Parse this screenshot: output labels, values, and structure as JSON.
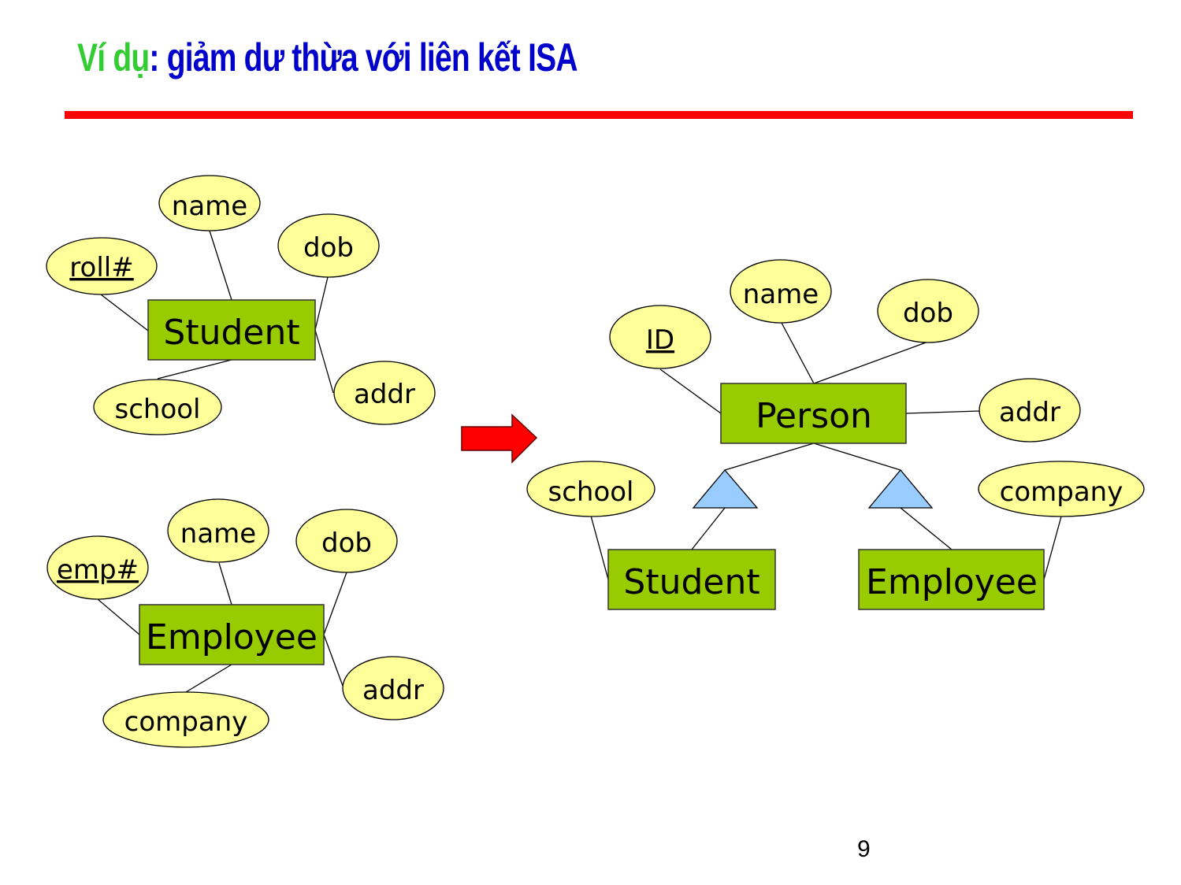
{
  "slide": {
    "title_prefix": "Ví dụ",
    "title_sep": ":",
    "title_main": " giảm dư thừa với liên kết ISA",
    "page_number": "9",
    "colors": {
      "title_prefix": "#33cc33",
      "title_main": "#0000cc",
      "rule": "#ff0000",
      "entity_fill": "#99cc00",
      "attribute_fill": "#ffff99",
      "isa_fill": "#99ccff",
      "arrow_fill": "#ff0000"
    }
  },
  "before": {
    "student": {
      "entity": "Student",
      "attributes": [
        {
          "label": "roll#",
          "key": true
        },
        {
          "label": "name",
          "key": false
        },
        {
          "label": "dob",
          "key": false
        },
        {
          "label": "addr",
          "key": false
        },
        {
          "label": "school",
          "key": false
        }
      ]
    },
    "employee": {
      "entity": "Employee",
      "attributes": [
        {
          "label": "emp#",
          "key": true
        },
        {
          "label": "name",
          "key": false
        },
        {
          "label": "dob",
          "key": false
        },
        {
          "label": "addr",
          "key": false
        },
        {
          "label": "company",
          "key": false
        }
      ]
    }
  },
  "after": {
    "person": {
      "entity": "Person",
      "attributes": [
        {
          "label": "ID",
          "key": true
        },
        {
          "label": "name",
          "key": false
        },
        {
          "label": "dob",
          "key": false
        },
        {
          "label": "addr",
          "key": false
        }
      ]
    },
    "subclasses": [
      {
        "entity": "Student",
        "relationship": "ISA",
        "attributes": [
          {
            "label": "school",
            "key": false
          }
        ]
      },
      {
        "entity": "Employee",
        "relationship": "ISA",
        "attributes": [
          {
            "label": "company",
            "key": false
          }
        ]
      }
    ]
  },
  "transform_arrow": "right-arrow"
}
